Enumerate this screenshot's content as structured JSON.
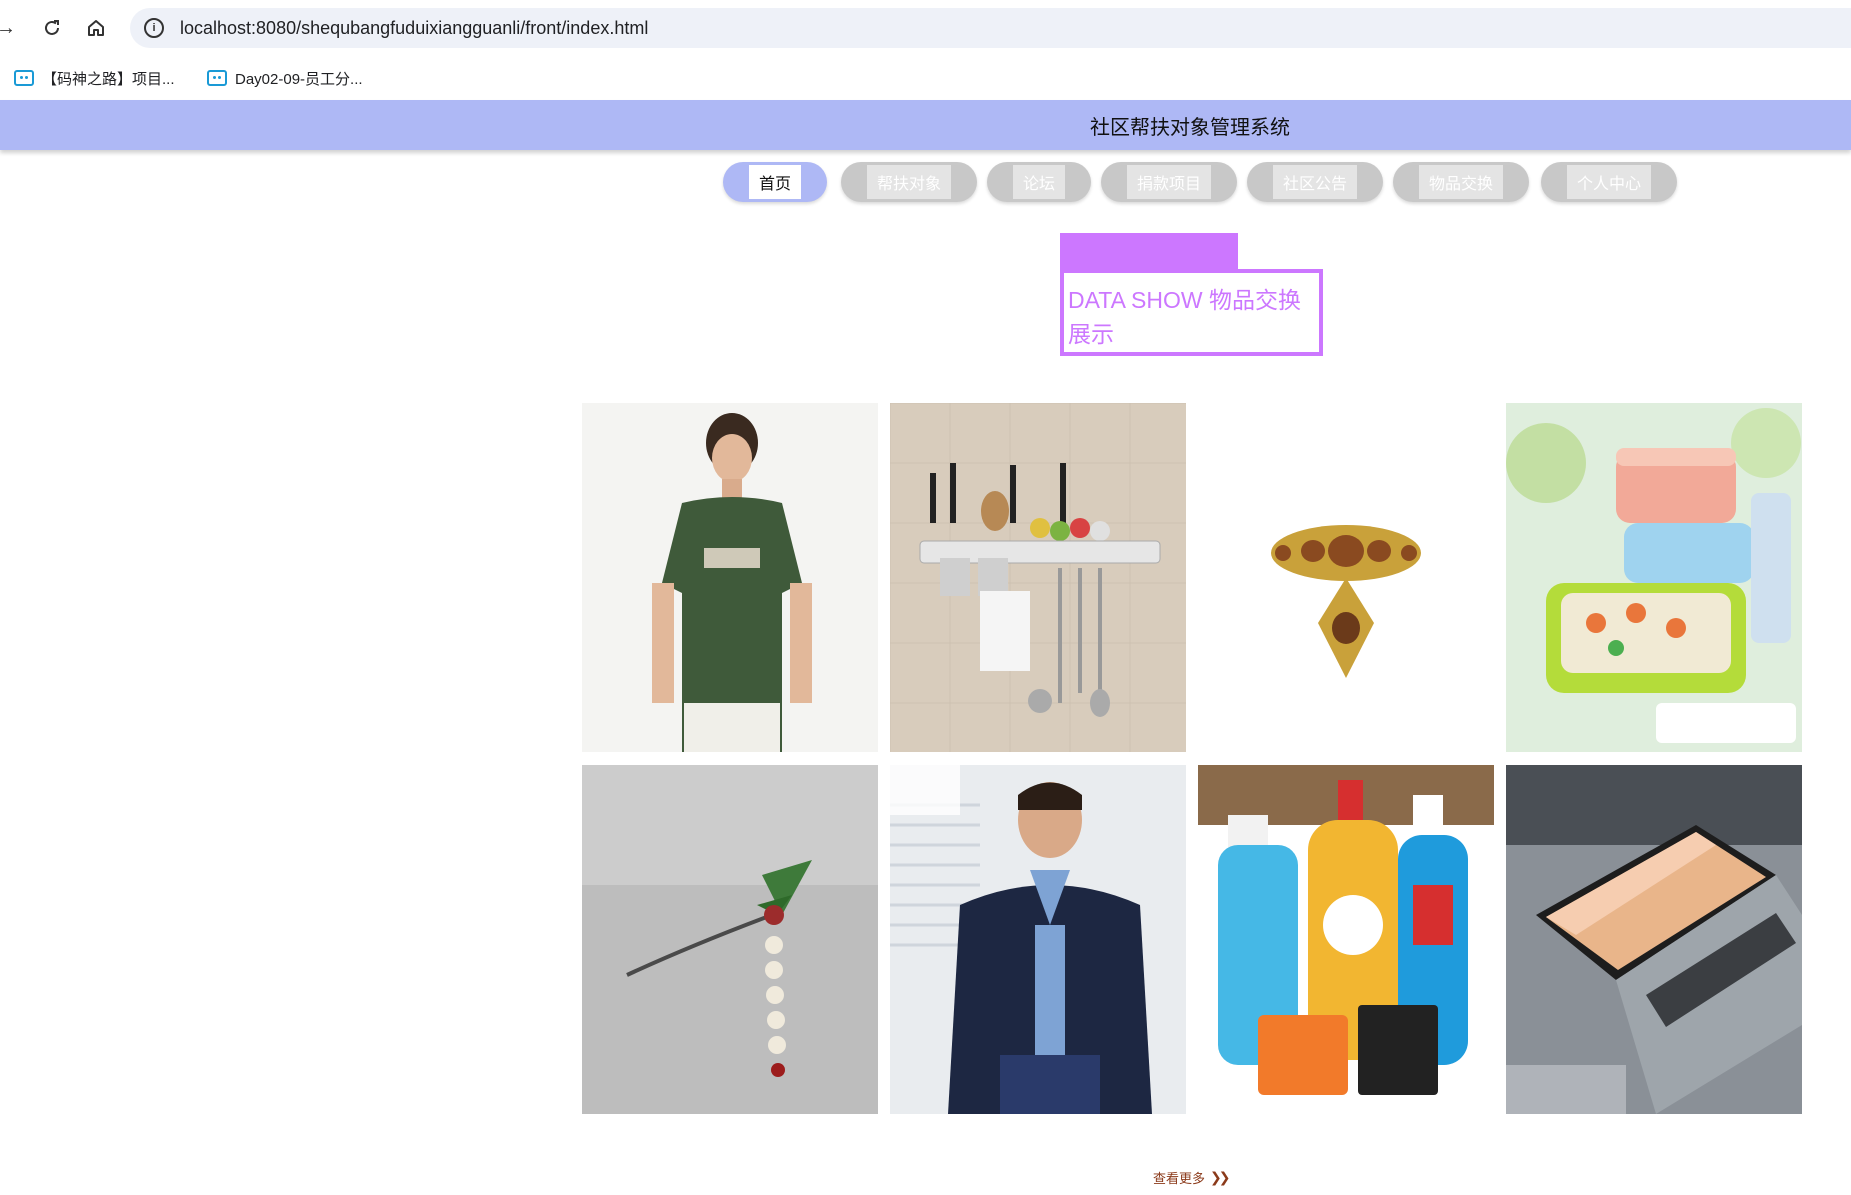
{
  "browser": {
    "url": "localhost:8080/shequbangfuduixiangguanli/front/index.html",
    "bookmarks": [
      {
        "label": "【码神之路】项目..."
      },
      {
        "label": "Day02-09-员工分..."
      }
    ]
  },
  "site": {
    "title": "社区帮扶对象管理系统"
  },
  "nav": {
    "items": [
      {
        "label": "首页",
        "active": true
      },
      {
        "label": "帮扶对象",
        "active": false
      },
      {
        "label": "论坛",
        "active": false
      },
      {
        "label": "捐款项目",
        "active": false
      },
      {
        "label": "社区公告",
        "active": false
      },
      {
        "label": "物品交换",
        "active": false
      },
      {
        "label": "个人中心",
        "active": false
      }
    ]
  },
  "section": {
    "title": "DATA SHOW 物品交换展示"
  },
  "products": [
    {
      "icon": "green-tshirt-image"
    },
    {
      "icon": "kitchen-rack-image"
    },
    {
      "icon": "brooch-image"
    },
    {
      "icon": "lunch-box-image"
    },
    {
      "icon": "hairpin-image"
    },
    {
      "icon": "jacket-image"
    },
    {
      "icon": "detergent-image"
    },
    {
      "icon": "laptop-image"
    }
  ],
  "view_more": {
    "label": "查看更多"
  },
  "colors": {
    "header": "#aeb8f5",
    "accent": "#cc77ff",
    "pill": "#c8c8c8",
    "view_more": "#8b3a1a"
  }
}
